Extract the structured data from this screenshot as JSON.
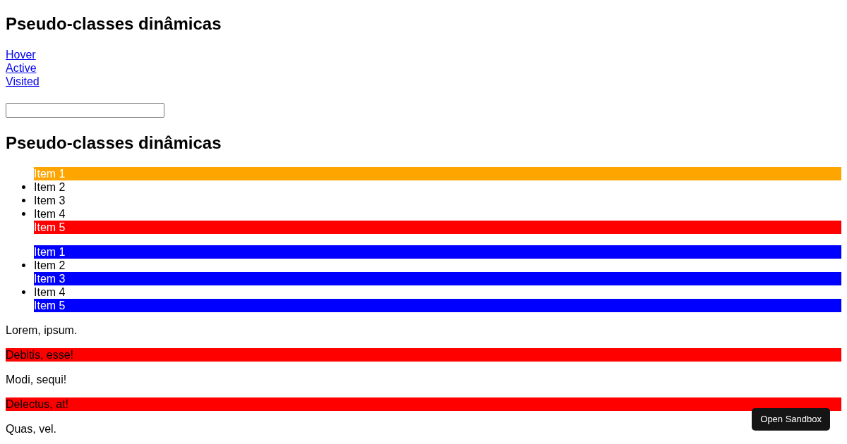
{
  "page_heading": "Pseudo-classes dinâmicas",
  "links": [
    "Hover",
    "Active",
    "Visited"
  ],
  "section_heading": "Pseudo-classes dinâmicas",
  "lists": [
    {
      "items": [
        {
          "label": "Item 1",
          "color": "#ffa500"
        },
        {
          "label": "Item 2"
        },
        {
          "label": "Item 3"
        },
        {
          "label": "Item 4"
        },
        {
          "label": "Item 5",
          "color": "#ff0000"
        }
      ]
    },
    {
      "items": [
        {
          "label": "Item 1",
          "color": "#0000ff"
        },
        {
          "label": "Item 2"
        },
        {
          "label": "Item 3",
          "color": "#0000ff"
        },
        {
          "label": "Item 4"
        },
        {
          "label": "Item 5",
          "color": "#0000ff"
        }
      ]
    }
  ],
  "paragraphs": [
    {
      "text": "Lorem, ipsum.",
      "highlighted": false
    },
    {
      "text": "Debitis, esse!",
      "highlighted": true
    },
    {
      "text": "Modi, sequi!",
      "highlighted": false
    },
    {
      "text": "Delectus, at!",
      "highlighted": true
    },
    {
      "text": "Quas, vel.",
      "highlighted": false
    }
  ],
  "sandbox_button": {
    "label": "Open Sandbox"
  }
}
